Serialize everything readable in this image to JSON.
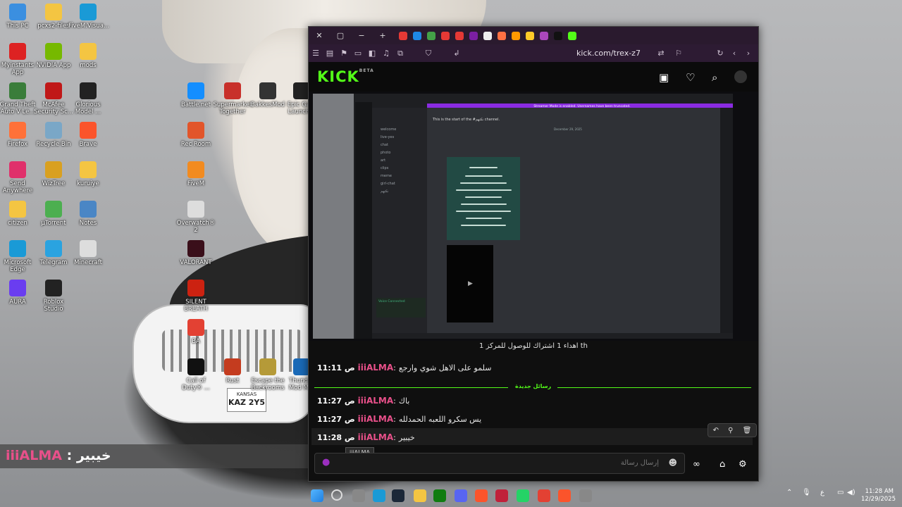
{
  "desktop_icons": [
    {
      "label": "This PC",
      "icon": "pc-icon",
      "color": "#3b8fe0"
    },
    {
      "label": "pcxs2-files",
      "icon": "folder-icon",
      "color": "#f4c542"
    },
    {
      "label": "FiveM.Visua...",
      "icon": "edge-icon",
      "color": "#1a9ad6"
    },
    {
      "label": "Myinstants App",
      "icon": "myinstants-icon",
      "color": "#d22"
    },
    {
      "label": "NVIDIA App",
      "icon": "nvidia-icon",
      "color": "#76b900"
    },
    {
      "label": "mods",
      "icon": "folder-icon",
      "color": "#f4c542"
    },
    {
      "label": "Grand Theft Auto V Le...",
      "icon": "gta-icon",
      "color": "#3a7d3a"
    },
    {
      "label": "McAfee Security Sc...",
      "icon": "mcafee-icon",
      "color": "#c01818"
    },
    {
      "label": "Glorious Model ...",
      "icon": "glorious-icon",
      "color": "#222"
    },
    {
      "label": "Firefox",
      "icon": "firefox-icon",
      "color": "#ff7139"
    },
    {
      "label": "Recycle Bin",
      "icon": "recycle-bin-icon",
      "color": "#7aa7c7"
    },
    {
      "label": "Brave",
      "icon": "brave-icon",
      "color": "#fb542b"
    },
    {
      "label": "Send Anywhere",
      "icon": "send-anywhere-icon",
      "color": "#e0306b"
    },
    {
      "label": "WizTree",
      "icon": "wiztree-icon",
      "color": "#d9a020"
    },
    {
      "label": "kuruiye",
      "icon": "folder-icon",
      "color": "#f4c542"
    },
    {
      "label": "citizen",
      "icon": "folder-icon",
      "color": "#f4c542"
    },
    {
      "label": "µTorrent",
      "icon": "utorrent-icon",
      "color": "#4caf50"
    },
    {
      "label": "Notes",
      "icon": "notes-icon",
      "color": "#4a86c5"
    },
    {
      "label": "Microsoft Edge",
      "icon": "edge-icon",
      "color": "#1a9ad6"
    },
    {
      "label": "Telegram",
      "icon": "telegram-icon",
      "color": "#2aa3e0"
    },
    {
      "label": "Minecraft",
      "icon": "file-icon",
      "color": "#dddddd"
    },
    {
      "label": "AURA",
      "icon": "aura-icon",
      "color": "#6a3df0"
    },
    {
      "label": "Roblox Studio",
      "icon": "roblox-icon",
      "color": "#222"
    },
    {
      "label": "Battle.net",
      "icon": "battlenet-icon",
      "color": "#148eff"
    },
    {
      "label": "Supermarket Together",
      "icon": "supermarket-icon",
      "color": "#c8302a"
    },
    {
      "label": "BakkesMod",
      "icon": "bakkesmod-icon",
      "color": "#333"
    },
    {
      "label": "Epic Ga... Launch...",
      "icon": "epic-icon",
      "color": "#222"
    },
    {
      "label": "Rec Room",
      "icon": "recroom-icon",
      "color": "#e2552a"
    },
    {
      "label": "FiveM",
      "icon": "fivem-icon",
      "color": "#f28b20"
    },
    {
      "label": "Overwatch® 2",
      "icon": "overwatch-icon",
      "color": "#ddd"
    },
    {
      "label": "VALORANT",
      "icon": "valorant-icon",
      "color": "#3a0f1a"
    },
    {
      "label": "SILENT BREATH",
      "icon": "silent-breath-icon",
      "color": "#c21"
    },
    {
      "label": "BA",
      "icon": "chrome-icon",
      "color": "#e34133"
    },
    {
      "label": "Call of Duty® ...",
      "icon": "cod-icon",
      "color": "#111"
    },
    {
      "label": "Rust",
      "icon": "rust-icon",
      "color": "#c43c1f"
    },
    {
      "label": "Escape the Backrooms",
      "icon": "backrooms-icon",
      "color": "#b59a38"
    },
    {
      "label": "Thunder Mod M...",
      "icon": "thunder-icon",
      "color": "#1a6ab8"
    }
  ],
  "car_plate": {
    "state": "KANSAS",
    "number": "KAZ 2Y5"
  },
  "overlay": {
    "username": "iiiALMA",
    "separator": ":",
    "message": "خيبير"
  },
  "browser": {
    "url": "kick.com/trex-z7",
    "tab_colors": [
      "#e53935",
      "#1e88e5",
      "#43a047",
      "#e53935",
      "#e53935",
      "#7b1fa2",
      "#eeeeee",
      "#ff7043",
      "#ff9800",
      "#ffca28",
      "#ab47bc",
      "#111111",
      "#53fc18"
    ]
  },
  "kick": {
    "logo": "KICK",
    "logo_badge": "BETA",
    "header_icons": [
      "browse-icon",
      "heart-icon",
      "search-icon",
      "avatar-icon"
    ]
  },
  "stream": {
    "discord_banner": "Streamer Mode is enabled. Usernames have been truncated.",
    "channel_start": "This is the start of the #نكتهم channel.",
    "date_divider": "December 29, 2025",
    "channels": [
      "welcome",
      "live-yes",
      "chat",
      "photo",
      "art",
      "clips",
      "meme",
      "girl-chat",
      "نكتهم"
    ],
    "voice_connected": "Voice Connected"
  },
  "chat": {
    "pinned": "اهداء 1 اشتراك للوصول للمركز 1 th",
    "messages": [
      {
        "time": "11:11 ص",
        "user": "iiiALMA",
        "sep": ":",
        "body": "سلمو على الاهل شوي وارجع"
      },
      {
        "time": "11:27 ص",
        "user": "iiiALMA",
        "sep": ":",
        "body": "باك"
      },
      {
        "time": "11:27 ص",
        "user": "iiiALMA",
        "sep": ":",
        "body": "يس سكرو اللعبه الحمدلله"
      },
      {
        "time": "11:28 ص",
        "user": "iiiALMA",
        "sep": ":",
        "body": "خيبير"
      }
    ],
    "new_messages_label": "رسائل جديدة",
    "tooltip": "iiiALMA",
    "input_placeholder": "إرسال رسالة",
    "actions": [
      "reply-icon",
      "pin-icon",
      "delete-icon"
    ]
  },
  "taskbar": {
    "clock_time": "11:28 AM",
    "clock_date": "12/29/2025",
    "tray_lang": "ع"
  }
}
